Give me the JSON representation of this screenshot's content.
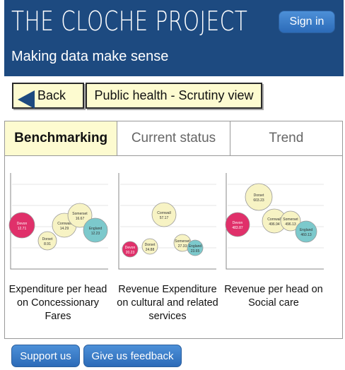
{
  "header": {
    "brand": "THE CLOCHE PROJECT",
    "tagline": "Making data make sense",
    "signin_label": "Sign in"
  },
  "nav": {
    "back_label": "Back",
    "page_title": "Public health - Scrutiny view"
  },
  "tabs": [
    {
      "label": "Benchmarking",
      "active": true
    },
    {
      "label": "Current status",
      "active": false
    },
    {
      "label": "Trend",
      "active": false
    }
  ],
  "colors": {
    "brand_blue": "#1d4a80",
    "devon": "#e0306a",
    "cornwall": "#f7f3c4",
    "dorset": "#f7f3c4",
    "somerset": "#f7f3c4",
    "england": "#7cc9cc"
  },
  "chart_data": [
    {
      "type": "scatter",
      "title": "Expenditure per head on Concessionary Fares",
      "points": [
        {
          "label": "Devon",
          "value": "12.71",
          "color": "#e0306a"
        },
        {
          "label": "Cornwall",
          "value": "14.29",
          "color": "#f7f3c4"
        },
        {
          "label": "Somerset",
          "value": "16.67",
          "color": "#f7f3c4"
        },
        {
          "label": "Dorset",
          "value": "8.91",
          "color": "#f7f3c4"
        },
        {
          "label": "England",
          "value": "12.23",
          "color": "#7cc9cc"
        }
      ]
    },
    {
      "type": "scatter",
      "title": "Revenue Expenditure on cultural and related services",
      "points": [
        {
          "label": "Cornwall",
          "value": "57.17",
          "color": "#f7f3c4"
        },
        {
          "label": "Devon",
          "value": "20.23",
          "color": "#e0306a"
        },
        {
          "label": "Dorset",
          "value": "24.88",
          "color": "#f7f3c4"
        },
        {
          "label": "Somerset",
          "value": "27.33",
          "color": "#f7f3c4"
        },
        {
          "label": "England",
          "value": "23.65",
          "color": "#7cc9cc"
        }
      ]
    },
    {
      "type": "scatter",
      "title": "Revenue per head on Social care",
      "points": [
        {
          "label": "Dorset",
          "value": "603.23",
          "color": "#f7f3c4"
        },
        {
          "label": "Devon",
          "value": "483.87",
          "color": "#e0306a"
        },
        {
          "label": "Cornwall",
          "value": "496.94",
          "color": "#f7f3c4"
        },
        {
          "label": "Somerset",
          "value": "496.13",
          "color": "#f7f3c4"
        },
        {
          "label": "England",
          "value": "460.13",
          "color": "#7cc9cc"
        }
      ]
    }
  ],
  "footer": {
    "support_label": "Support us",
    "feedback_label": "Give us feedback"
  }
}
